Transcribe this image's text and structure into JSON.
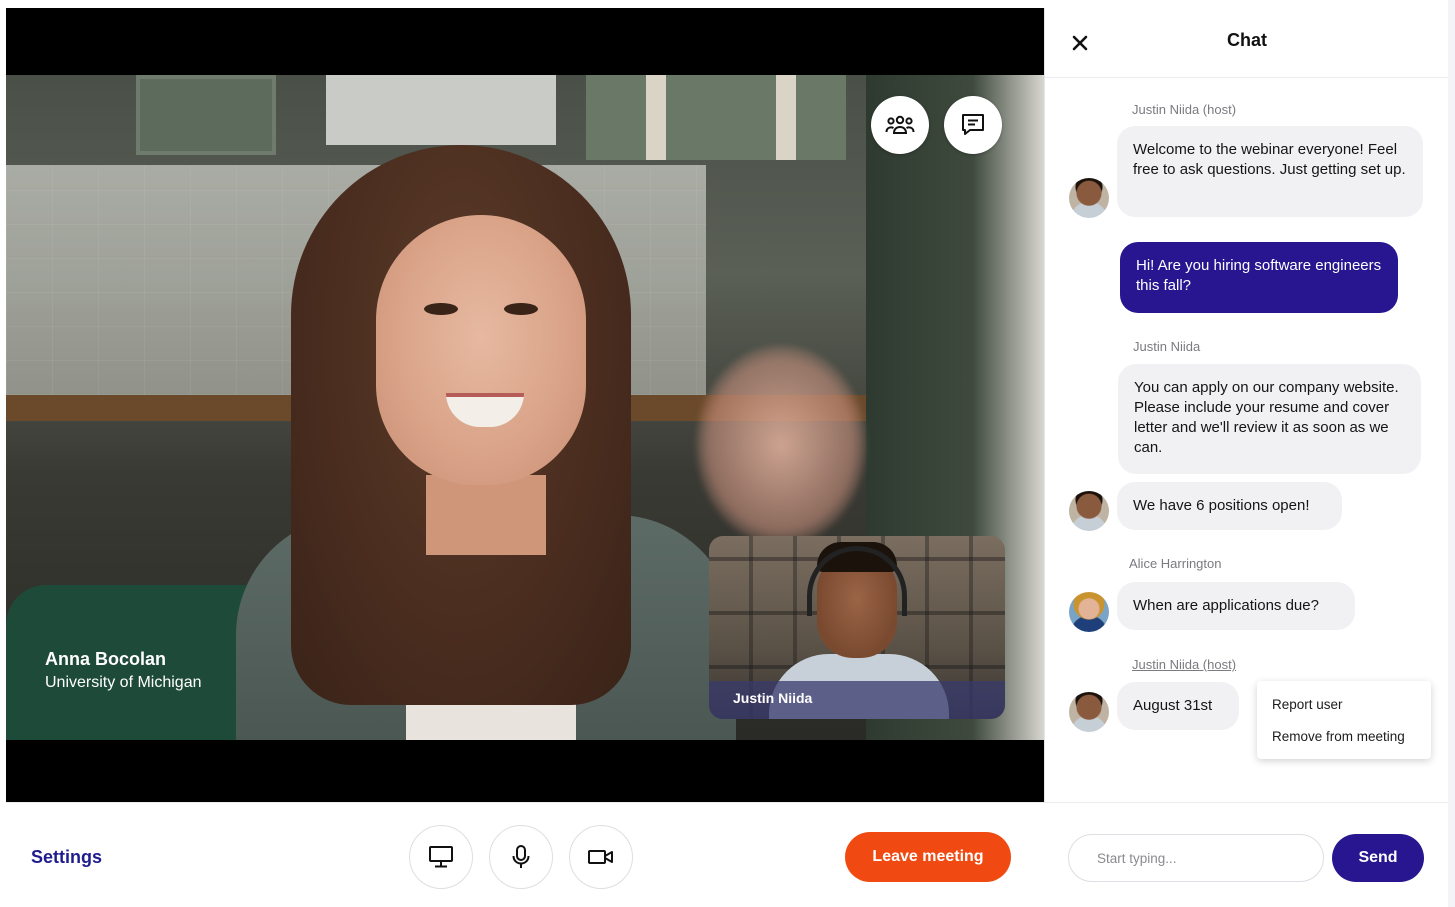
{
  "main_video": {
    "participant_name": "Anna Bocolan",
    "participant_affiliation": "University of Michigan",
    "overlay_buttons": [
      {
        "icon": "people-icon"
      },
      {
        "icon": "chat-icon"
      }
    ]
  },
  "pip_video": {
    "participant_name": "Justin Niida"
  },
  "chat": {
    "title": "Chat",
    "close_icon": "close-icon",
    "messages": [
      {
        "sender": "Justin Niida (host)",
        "text": "Welcome to the webinar everyone! Feel free to ask questions. Just getting set up.",
        "own": false
      },
      {
        "sender": "",
        "text": "Hi! Are you hiring software engineers this fall?",
        "own": true
      },
      {
        "sender": "Justin Niida",
        "text": "You can apply on our company website. Please include your resume and cover letter and we'll review it as soon as we can.",
        "own": false
      },
      {
        "sender": "",
        "text": "We have 6 positions open!",
        "own": false
      },
      {
        "sender": "Alice Harrington",
        "text": "When are applications due?",
        "own": false
      },
      {
        "sender": "Justin Niida (host)",
        "text": "August 31st",
        "own": false
      }
    ],
    "context_menu": {
      "items": [
        "Report user",
        "Remove from meeting"
      ]
    },
    "input_placeholder": "Start typing...",
    "send_label": "Send"
  },
  "bottom_bar": {
    "settings_label": "Settings",
    "controls": [
      {
        "icon": "monitor-icon"
      },
      {
        "icon": "microphone-icon"
      },
      {
        "icon": "video-camera-icon"
      }
    ],
    "leave_label": "Leave meeting"
  },
  "colors": {
    "accent": "#27168f",
    "leave": "#f04a12",
    "bubble": "#f1f1f4"
  }
}
